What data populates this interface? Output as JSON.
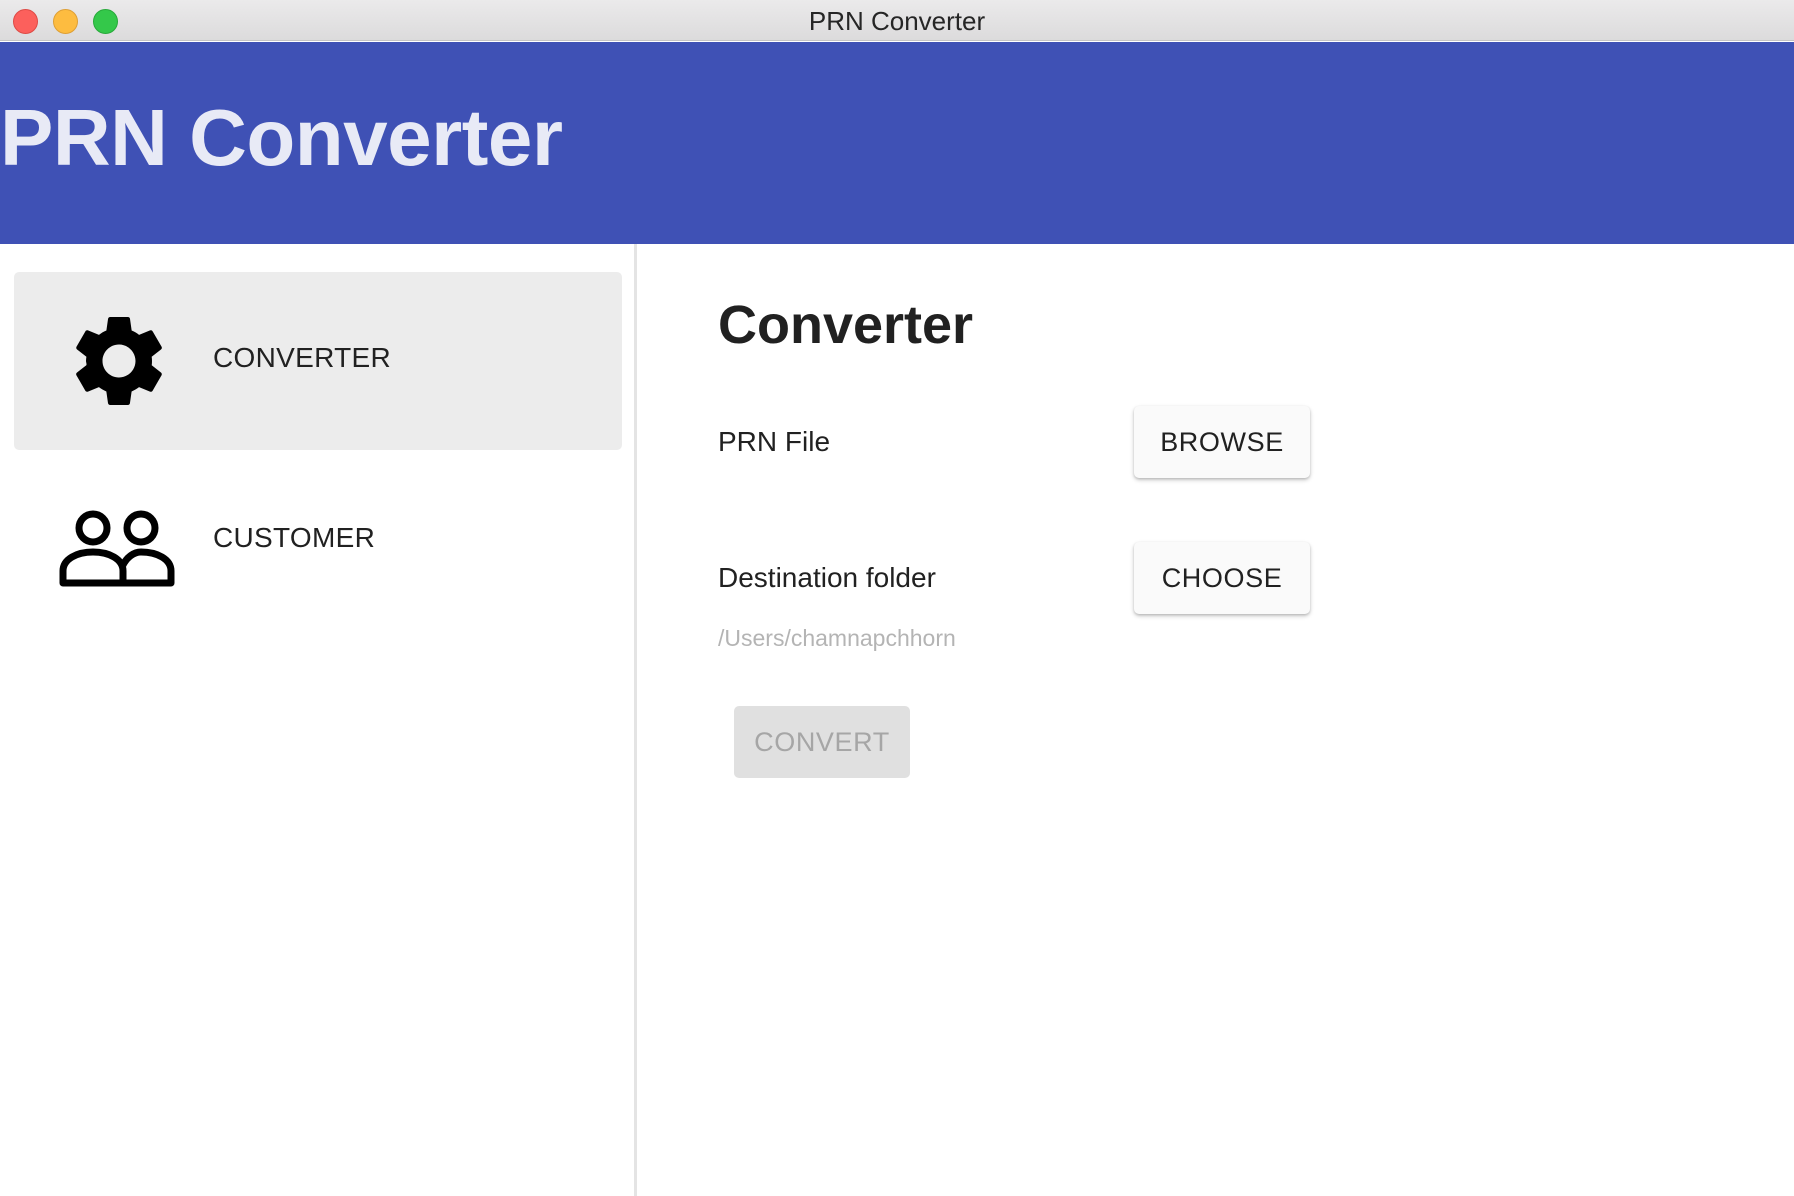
{
  "window": {
    "title": "PRN Converter"
  },
  "header": {
    "title": "PRN Converter",
    "background_color": "#3f51b5"
  },
  "sidebar": {
    "items": [
      {
        "label": "CONVERTER",
        "icon": "gear-icon",
        "active": true
      },
      {
        "label": "CUSTOMER",
        "icon": "people-icon",
        "active": false
      }
    ]
  },
  "main": {
    "title": "Converter",
    "prn_file": {
      "label": "PRN File",
      "button_label": "BROWSE"
    },
    "destination": {
      "label": "Destination folder",
      "button_label": "CHOOSE",
      "path": "/Users/chamnapchhorn"
    },
    "convert_button": {
      "label": "CONVERT",
      "disabled": true
    }
  }
}
